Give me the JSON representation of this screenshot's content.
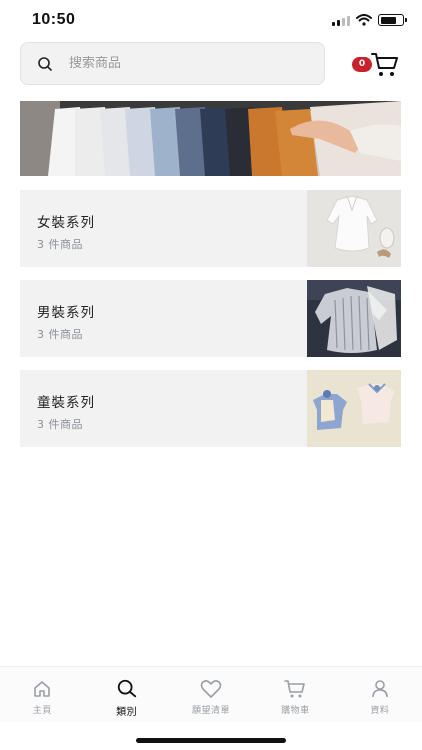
{
  "status_bar": {
    "time": "10:50"
  },
  "header": {
    "search_placeholder": "搜索商品",
    "cart_count": "0"
  },
  "categories": [
    {
      "title": "女裝系列",
      "count": "3 件商品"
    },
    {
      "title": "男裝系列",
      "count": "3 件商品"
    },
    {
      "title": "童裝系列",
      "count": "3 件商品"
    }
  ],
  "tab_bar": {
    "active": "類別",
    "tabs": [
      {
        "label": "主頁",
        "icon": "home-icon"
      },
      {
        "label": "類別",
        "icon": "search-icon"
      },
      {
        "label": "願望清單",
        "icon": "heart-icon"
      },
      {
        "label": "購物車",
        "icon": "cart-icon"
      },
      {
        "label": "資料",
        "icon": "profile-icon"
      }
    ]
  },
  "colors": {
    "badge": "#c8222c",
    "card_bg": "#f2f2f2",
    "tab_inactive": "#9a9ea6"
  }
}
